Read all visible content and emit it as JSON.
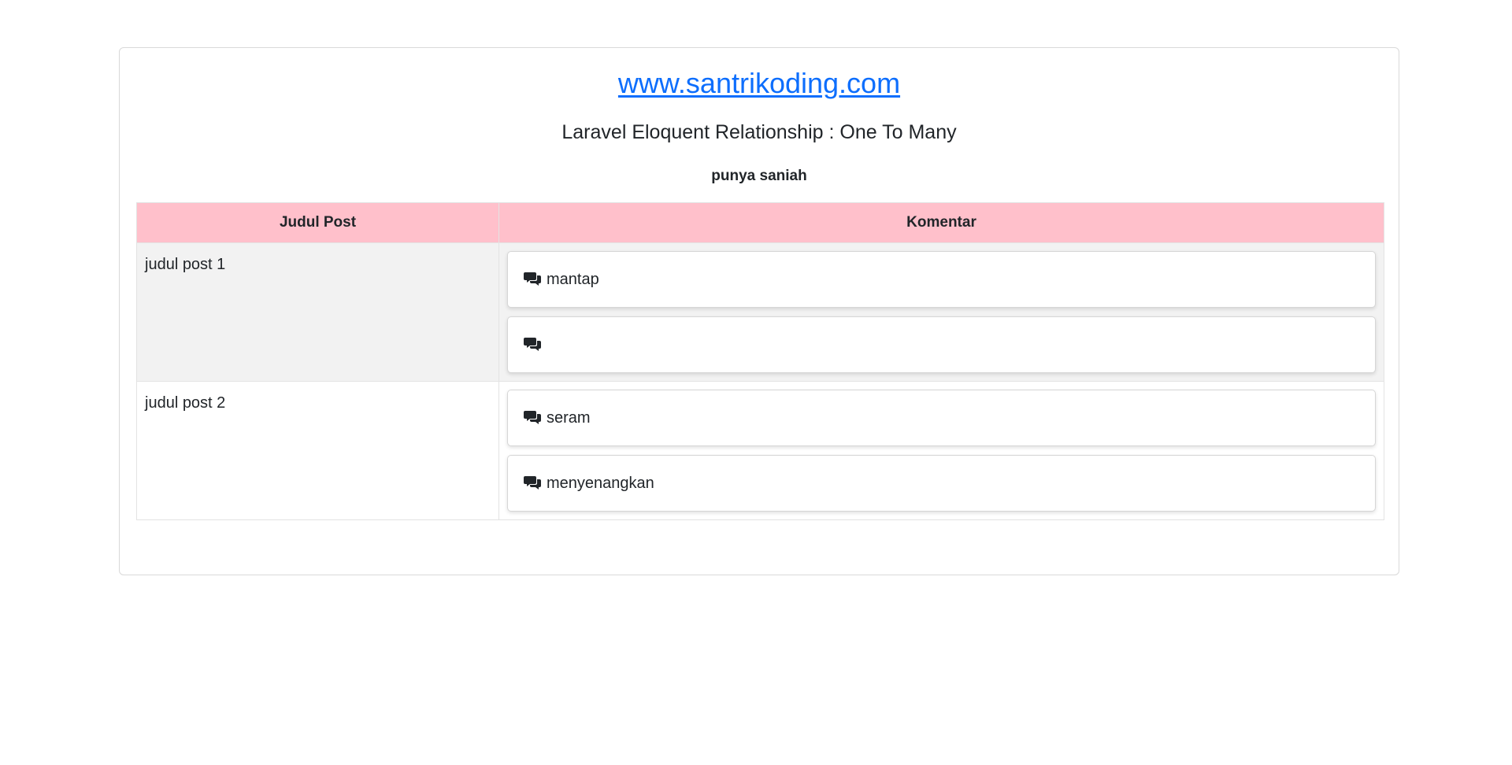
{
  "header": {
    "site_link": "www.santrikoding.com",
    "title": "Laravel Eloquent Relationship : One To Many",
    "subtitle": "punya saniah"
  },
  "table": {
    "columns": [
      "Judul Post",
      "Komentar"
    ],
    "header_color": "#ffc0cb",
    "rows": [
      {
        "title": "judul post 1",
        "comments": [
          {
            "icon": "comments-icon",
            "text": "mantap"
          },
          {
            "icon": "comments-icon",
            "text": ""
          }
        ]
      },
      {
        "title": "judul post 2",
        "comments": [
          {
            "icon": "comments-icon",
            "text": "seram"
          },
          {
            "icon": "comments-icon",
            "text": "menyenangkan"
          }
        ]
      }
    ]
  },
  "colors": {
    "link": "#0d6efd",
    "striped_row": "#f2f2f2"
  }
}
